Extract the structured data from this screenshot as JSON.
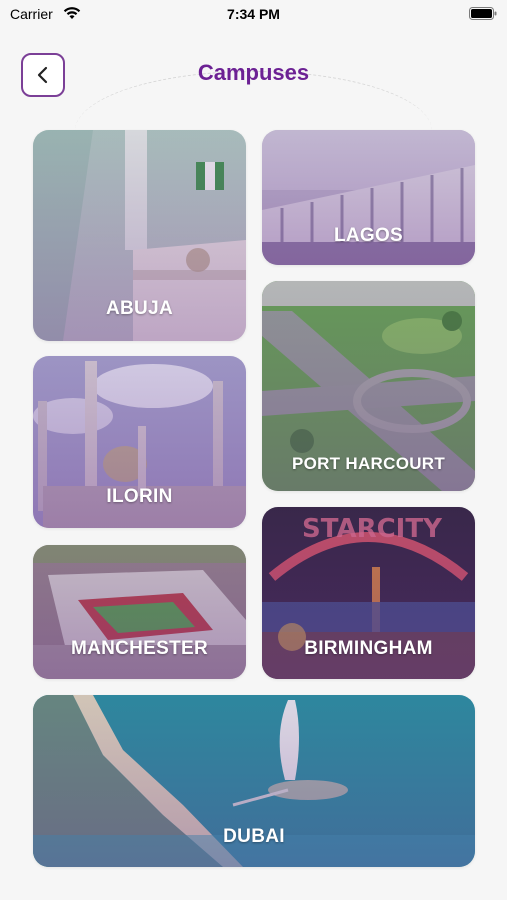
{
  "status_bar": {
    "carrier": "Carrier",
    "time": "7:34 PM"
  },
  "header": {
    "title": "Campuses",
    "back_icon": "chevron-left-icon"
  },
  "campuses": [
    {
      "name": "ABUJA"
    },
    {
      "name": "LAGOS"
    },
    {
      "name": "ILORIN"
    },
    {
      "name": "PORT HARCOURT"
    },
    {
      "name": "MANCHESTER"
    },
    {
      "name": "BIRMINGHAM"
    },
    {
      "name": "DUBAI"
    }
  ],
  "colors": {
    "brand_purple": "#6c2194",
    "back_border": "#7b3f97",
    "background": "#f6f6f6"
  }
}
